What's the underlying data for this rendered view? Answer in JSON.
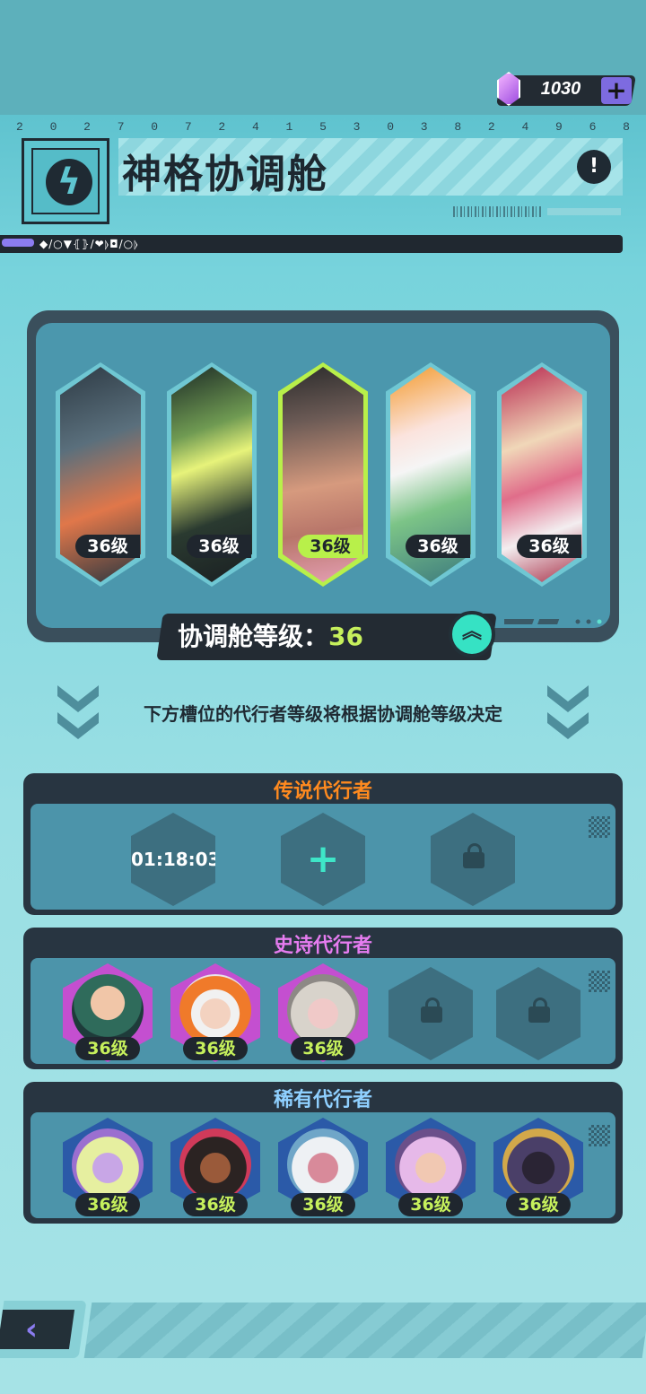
{
  "currency": {
    "amount": "1030",
    "icon": "crystal-gem-icon",
    "add_icon": "plus-icon"
  },
  "header": {
    "digits": [
      "2",
      "0",
      "2",
      "7",
      "0",
      "7",
      "2",
      "4",
      "1",
      "5",
      "3",
      "0",
      "3",
      "8",
      "2",
      "4",
      "9",
      "6",
      "8"
    ],
    "title": "神格协调舱",
    "info_icon": "!",
    "deco_symbols": "◆/○▼⦃⦄/❤⦊◘/○⦊"
  },
  "pod": {
    "cards": [
      {
        "level": "36级",
        "selected": false
      },
      {
        "level": "36级",
        "selected": false
      },
      {
        "level": "36级",
        "selected": true
      },
      {
        "level": "36级",
        "selected": false
      },
      {
        "level": "36级",
        "selected": false
      }
    ],
    "level_label": "协调舱等级：",
    "level_value": "36",
    "upgrade_icon": "︽"
  },
  "hint": "下方槽位的代行者等级将根据协调舱等级决定",
  "sections": {
    "legendary": {
      "title": "传说代行者",
      "title_color": "#ff8a1f",
      "timer": "01:18:03",
      "plus": "+"
    },
    "epic": {
      "title": "史诗代行者",
      "title_color": "#e67cf0",
      "levels": [
        "36级",
        "36级",
        "36级"
      ]
    },
    "rare": {
      "title": "稀有代行者",
      "title_color": "#8fd0ff",
      "levels": [
        "36级",
        "36级",
        "36级",
        "36级",
        "36级"
      ]
    }
  },
  "nav": {
    "back": "‹"
  }
}
